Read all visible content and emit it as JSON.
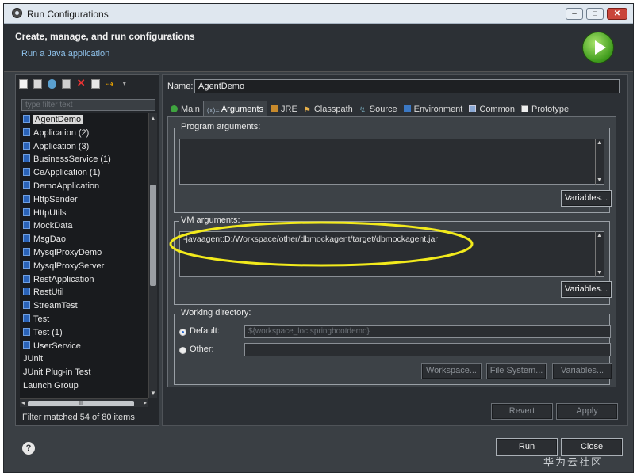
{
  "window": {
    "title": "Run Configurations",
    "controls": [
      "–",
      "□",
      "✕"
    ]
  },
  "header": {
    "title": "Create, manage, and run configurations",
    "subtitle": "Run a Java application"
  },
  "left": {
    "filter_placeholder": "type filter text",
    "items": [
      {
        "label": "AgentDemo",
        "icon": "java-app-icon",
        "selected": true
      },
      {
        "label": "Application (2)",
        "icon": "java-app-icon"
      },
      {
        "label": "Application (3)",
        "icon": "java-app-icon"
      },
      {
        "label": "BusinessService (1)",
        "icon": "java-app-icon"
      },
      {
        "label": "CeApplication (1)",
        "icon": "java-app-icon"
      },
      {
        "label": "DemoApplication",
        "icon": "java-app-icon"
      },
      {
        "label": "HttpSender",
        "icon": "java-app-icon"
      },
      {
        "label": "HttpUtils",
        "icon": "java-app-icon"
      },
      {
        "label": "MockData",
        "icon": "java-app-icon"
      },
      {
        "label": "MsgDao",
        "icon": "java-app-icon"
      },
      {
        "label": "MysqlProxyDemo",
        "icon": "java-app-icon"
      },
      {
        "label": "MysqlProxyServer",
        "icon": "java-app-icon"
      },
      {
        "label": "RestApplication",
        "icon": "java-app-icon"
      },
      {
        "label": "RestUtil",
        "icon": "java-app-icon"
      },
      {
        "label": "StreamTest",
        "icon": "java-app-icon"
      },
      {
        "label": "Test",
        "icon": "java-app-icon"
      },
      {
        "label": "Test (1)",
        "icon": "java-app-icon"
      },
      {
        "label": "UserService",
        "icon": "java-app-icon"
      },
      {
        "label": "JUnit",
        "icon": ""
      },
      {
        "label": "JUnit Plug-in Test",
        "icon": ""
      },
      {
        "label": "Launch Group",
        "icon": ""
      }
    ],
    "hscroll_label": "III",
    "status": "Filter matched 54 of 80 items"
  },
  "right": {
    "name_label": "Name:",
    "name_value": "AgentDemo",
    "tabs": [
      {
        "label": "Main",
        "icon": "main-icon"
      },
      {
        "label": "Arguments",
        "icon": "arguments-icon",
        "active": true
      },
      {
        "label": "JRE",
        "icon": "jre-icon"
      },
      {
        "label": "Classpath",
        "icon": "classpath-icon"
      },
      {
        "label": "Source",
        "icon": "source-icon"
      },
      {
        "label": "Environment",
        "icon": "environment-icon"
      },
      {
        "label": "Common",
        "icon": "common-icon"
      },
      {
        "label": "Prototype",
        "icon": "prototype-icon"
      }
    ],
    "program_args": {
      "legend": "Program arguments:",
      "value": "",
      "variables_label": "Variables..."
    },
    "vm_args": {
      "legend": "VM arguments:",
      "value": "-javaagent:D:/Workspace/other/dbmockagent/target/dbmockagent.jar",
      "variables_label": "Variables..."
    },
    "working_dir": {
      "legend": "Working directory:",
      "default_label": "Default:",
      "default_value": "${workspace_loc:springbootdemo}",
      "other_label": "Other:",
      "other_value": "",
      "workspace_btn": "Workspace...",
      "filesystem_btn": "File System...",
      "variables_btn": "Variables..."
    },
    "revert_label": "Revert",
    "apply_label": "Apply"
  },
  "footer": {
    "help": "?",
    "run_label": "Run",
    "close_label": "Close"
  },
  "watermark": "华为云社区",
  "colors": {
    "annotation_ellipse": "#f2ea1c",
    "selection": "#d9d9d9",
    "run_badge": "#4caf26"
  }
}
